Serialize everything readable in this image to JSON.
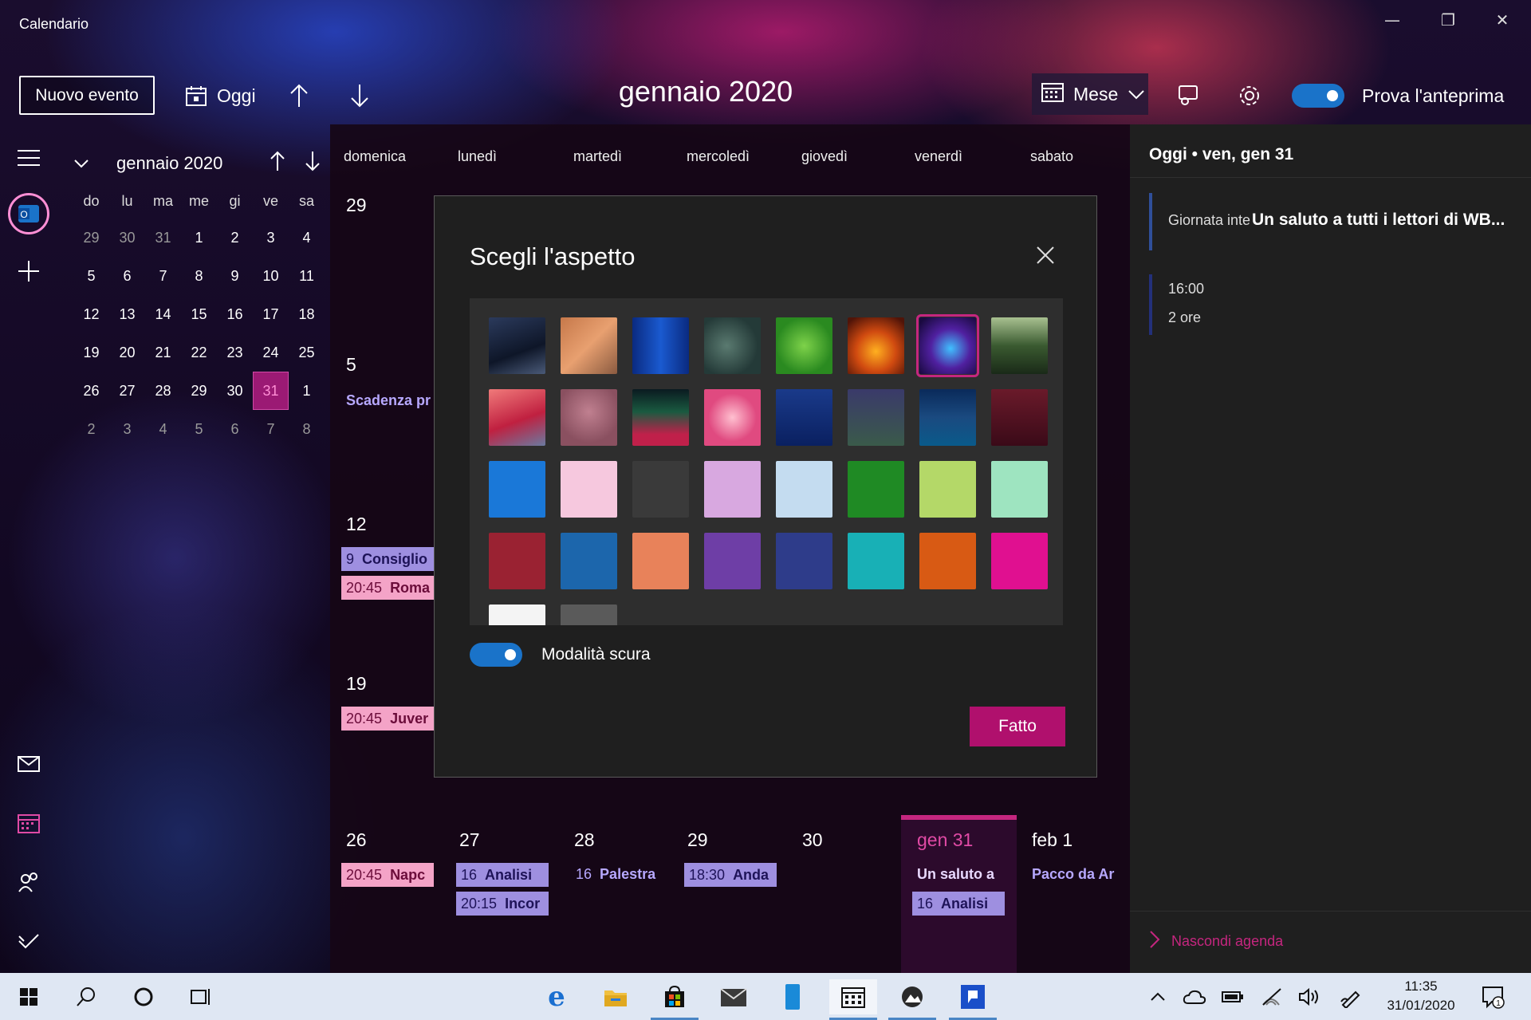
{
  "app": {
    "title": "Calendario"
  },
  "toolbar": {
    "new_event": "Nuovo evento",
    "today": "Oggi",
    "view": "Mese",
    "preview": "Prova l'anteprima"
  },
  "main": {
    "title": "gennaio 2020"
  },
  "mini_calendar": {
    "title": "gennaio 2020",
    "dow": [
      "do",
      "lu",
      "ma",
      "me",
      "gi",
      "ve",
      "sa"
    ],
    "weeks": [
      [
        "29",
        "30",
        "31",
        "1",
        "2",
        "3",
        "4"
      ],
      [
        "5",
        "6",
        "7",
        "8",
        "9",
        "10",
        "11"
      ],
      [
        "12",
        "13",
        "14",
        "15",
        "16",
        "17",
        "18"
      ],
      [
        "19",
        "20",
        "21",
        "22",
        "23",
        "24",
        "25"
      ],
      [
        "26",
        "27",
        "28",
        "29",
        "30",
        "31",
        "1"
      ],
      [
        "2",
        "3",
        "4",
        "5",
        "6",
        "7",
        "8"
      ]
    ],
    "today": "31"
  },
  "month": {
    "dow": [
      "domenica",
      "lunedì",
      "martedì",
      "mercoledì",
      "giovedì",
      "venerdì",
      "sabato"
    ],
    "week_starts": [
      "29",
      "5",
      "12",
      "19"
    ],
    "events": {
      "w2_text": "Scadenza pr",
      "w3_ev1_time": "9",
      "w3_ev1_title": "Consiglio",
      "w3_ev2_time": "20:45",
      "w3_ev2_title": "Roma",
      "w4_ev1_time": "20:45",
      "w4_ev1_title": "Juver"
    },
    "last_week": {
      "days": [
        "26",
        "27",
        "28",
        "29",
        "30",
        "gen 31",
        "feb 1"
      ],
      "d26_time": "20:45",
      "d26_title": "Napc",
      "d27_ev1_time": "16",
      "d27_ev1_title": "Analisi",
      "d27_ev2_time": "20:15",
      "d27_ev2_title": "Incor",
      "d28_time": "16",
      "d28_title": "Palestra",
      "d29_time": "18:30",
      "d29_title": "Anda",
      "d31_text": "Un saluto a",
      "d31_ev_time": "16",
      "d31_ev_title": "Analisi",
      "feb1_text": "Pacco da Ar"
    }
  },
  "agenda": {
    "header": "Oggi • ven, gen 31",
    "allday_label": "Giornata inte",
    "allday_title": "Un saluto a tutti i lettori di WB...",
    "ev_time": "16:00",
    "ev_duration": "2 ore",
    "hide": "Nascondi agenda"
  },
  "dialog": {
    "title": "Scegli l'aspetto",
    "dark_mode": "Modalità scura",
    "done": "Fatto"
  },
  "taskbar": {
    "time": "11:35",
    "date": "31/01/2020",
    "notif_count": "1"
  },
  "colors": {
    "accent": "#b0106d",
    "today_bg": "#9b1a74",
    "event_pink": "#f4a3c7",
    "event_lavender": "#9e8fe0",
    "toggle_blue": "#1a73c9"
  }
}
